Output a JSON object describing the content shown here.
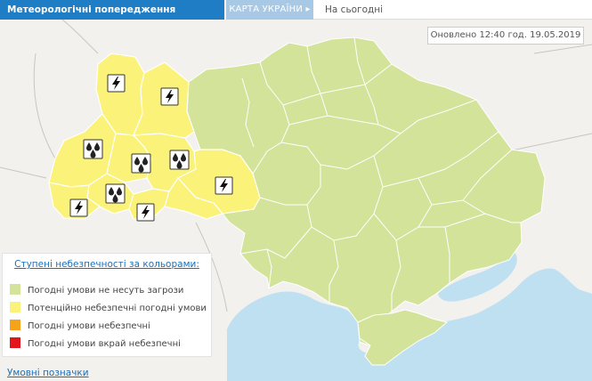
{
  "header": {
    "title": "Метеорологічні попередження",
    "map_tab": "КАРТА УКРАЇНИ",
    "map_tab_arrow": "▸",
    "day_tab": "На сьогодні"
  },
  "updated": "Оновлено 12:40 год. 19.05.2019",
  "legend": {
    "title": "Ступені небезпечності за кольорами:",
    "items": [
      {
        "label": "Погодні умови не несуть загрози",
        "color": "#d3e39a"
      },
      {
        "label": "Потенційно небезпечні погодні умови",
        "color": "#fbf27a"
      },
      {
        "label": "Погодні умови небезпечні",
        "color": "#f7a21b"
      },
      {
        "label": "Погодні умови вкрай небезпечні",
        "color": "#e1151b"
      }
    ]
  },
  "legend_link": "Умовні позначки",
  "colors": {
    "background": "#f2f1ee",
    "sea": "#bfe0f1",
    "no_threat": "#d3e39a",
    "potential": "#fbf27a",
    "border": "#ffffff",
    "header": "#1e7dc5"
  },
  "icons": {
    "lightning": "lightning-icon",
    "rain": "rain-drops-icon"
  }
}
